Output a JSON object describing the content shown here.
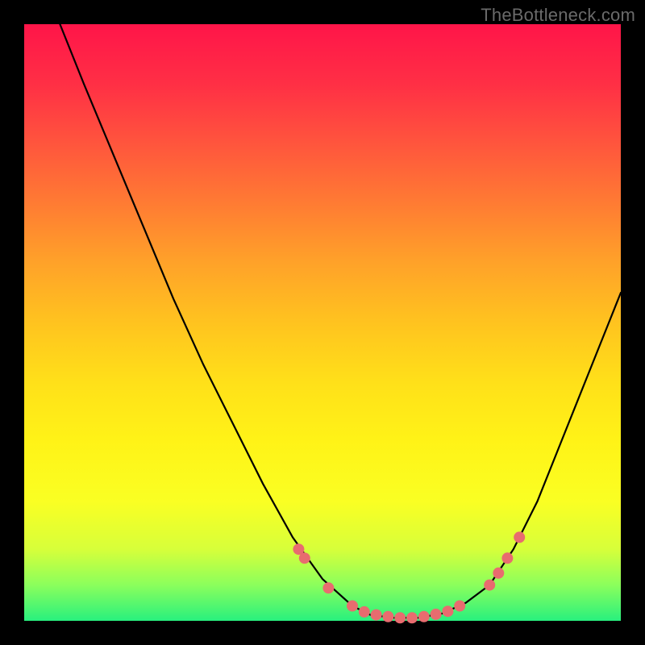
{
  "watermark": "TheBottleneck.com",
  "chart_data": {
    "type": "line",
    "title": "",
    "xlabel": "",
    "ylabel": "",
    "xlim": [
      0,
      100
    ],
    "ylim": [
      0,
      100
    ],
    "curve": {
      "name": "bottleneck-curve",
      "color": "#000000",
      "points": [
        {
          "x": 6,
          "y": 100
        },
        {
          "x": 10,
          "y": 90
        },
        {
          "x": 15,
          "y": 78
        },
        {
          "x": 20,
          "y": 66
        },
        {
          "x": 25,
          "y": 54
        },
        {
          "x": 30,
          "y": 43
        },
        {
          "x": 35,
          "y": 33
        },
        {
          "x": 40,
          "y": 23
        },
        {
          "x": 45,
          "y": 14
        },
        {
          "x": 50,
          "y": 7
        },
        {
          "x": 55,
          "y": 2.5
        },
        {
          "x": 58,
          "y": 1
        },
        {
          "x": 62,
          "y": 0.5
        },
        {
          "x": 66,
          "y": 0.5
        },
        {
          "x": 70,
          "y": 1.2
        },
        {
          "x": 74,
          "y": 3
        },
        {
          "x": 78,
          "y": 6
        },
        {
          "x": 82,
          "y": 12
        },
        {
          "x": 86,
          "y": 20
        },
        {
          "x": 90,
          "y": 30
        },
        {
          "x": 94,
          "y": 40
        },
        {
          "x": 98,
          "y": 50
        },
        {
          "x": 100,
          "y": 55
        }
      ]
    },
    "markers": {
      "name": "highlight-points",
      "color": "#e86c6f",
      "radius": 7,
      "points": [
        {
          "x": 46,
          "y": 12
        },
        {
          "x": 47,
          "y": 10.5
        },
        {
          "x": 51,
          "y": 5.5
        },
        {
          "x": 55,
          "y": 2.5
        },
        {
          "x": 57,
          "y": 1.5
        },
        {
          "x": 59,
          "y": 1
        },
        {
          "x": 61,
          "y": 0.7
        },
        {
          "x": 63,
          "y": 0.5
        },
        {
          "x": 65,
          "y": 0.5
        },
        {
          "x": 67,
          "y": 0.7
        },
        {
          "x": 69,
          "y": 1.1
        },
        {
          "x": 71,
          "y": 1.6
        },
        {
          "x": 73,
          "y": 2.5
        },
        {
          "x": 78,
          "y": 6
        },
        {
          "x": 79.5,
          "y": 8
        },
        {
          "x": 81,
          "y": 10.5
        },
        {
          "x": 83,
          "y": 14
        }
      ]
    }
  }
}
